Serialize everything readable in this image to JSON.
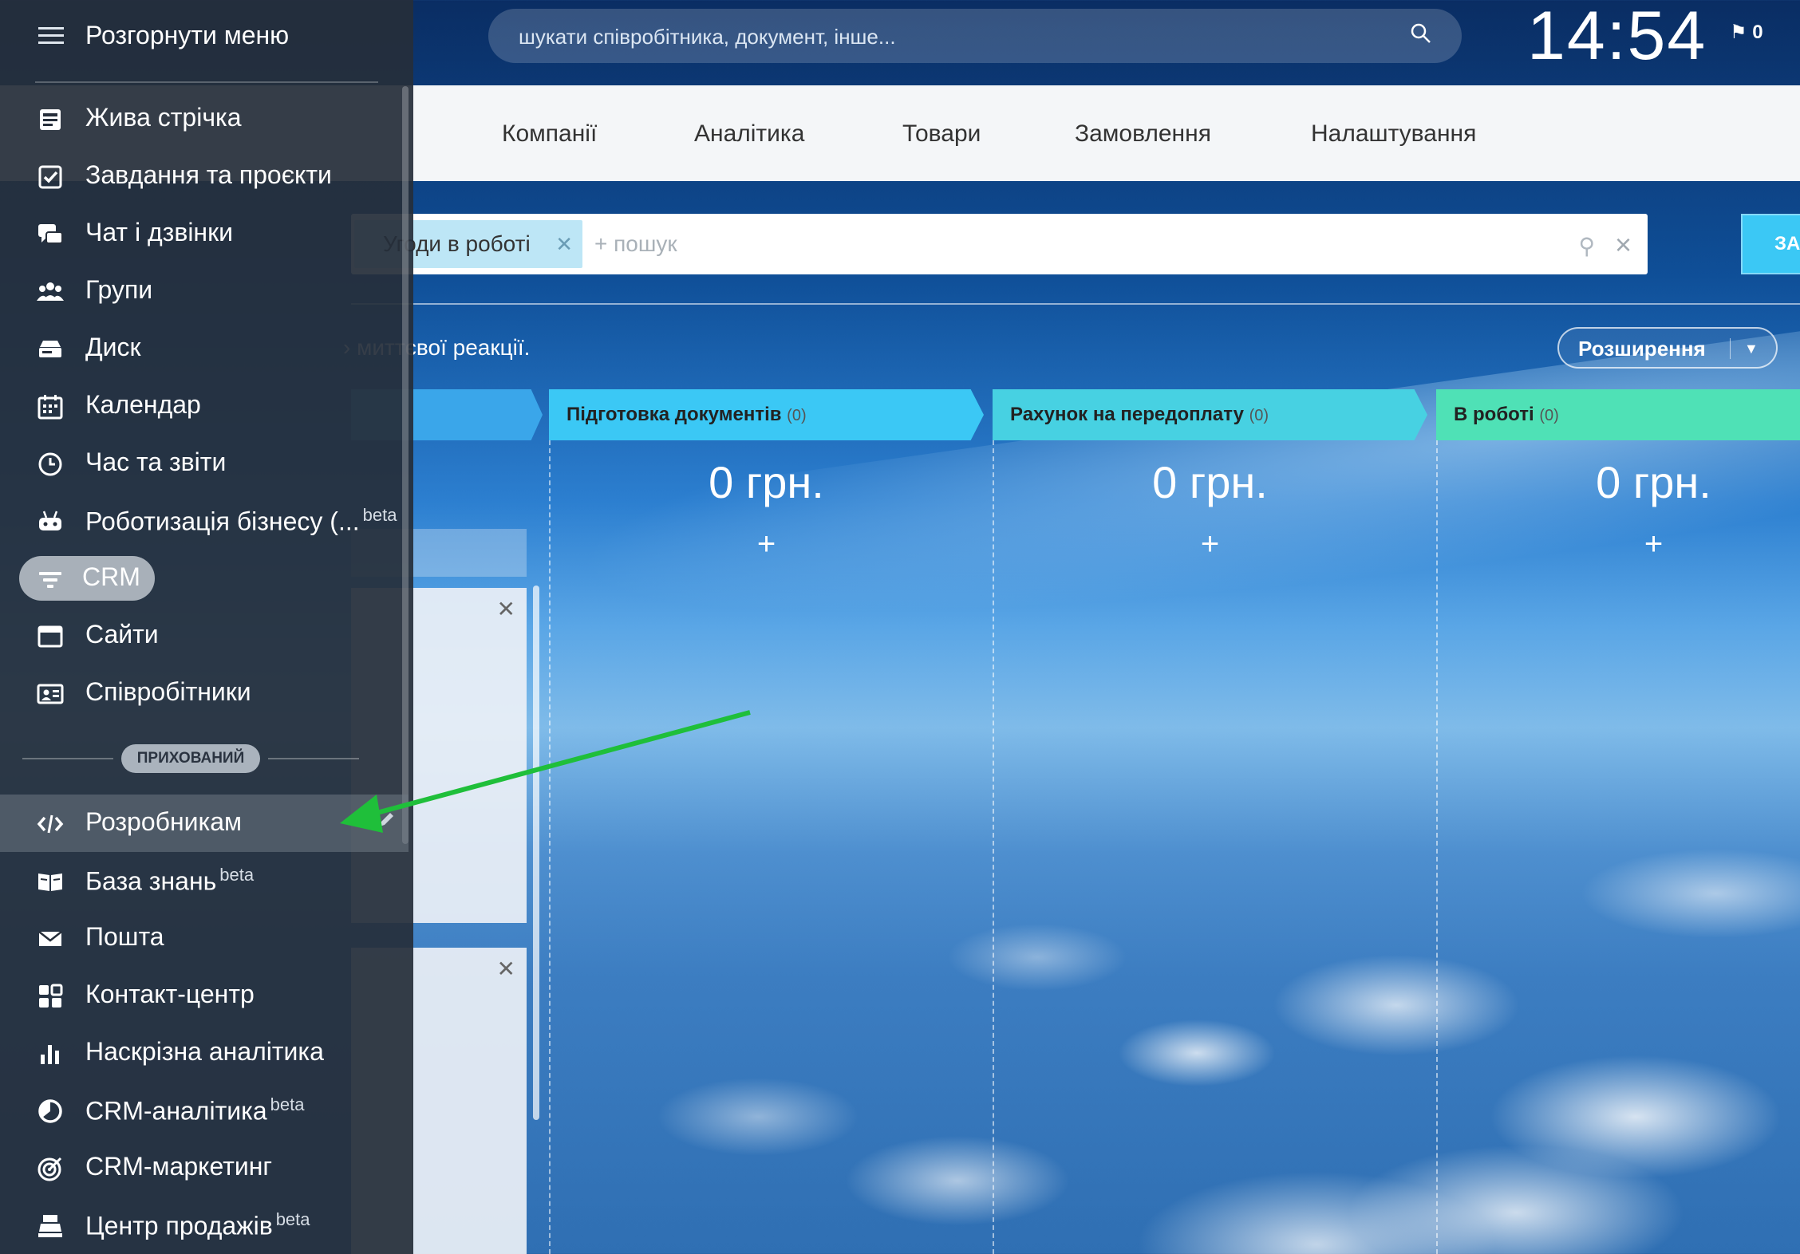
{
  "header": {
    "search_placeholder": "шукати співробітника, документ, інше...",
    "clock": "14:54",
    "flag_count": "0"
  },
  "topnav": {
    "items": [
      "Компанії",
      "Аналітика",
      "Товари",
      "Замовлення",
      "Налаштування"
    ]
  },
  "filter": {
    "chip_label": "Угоди в роботі",
    "search_placeholder": "+ пошук",
    "add_button": "ЗА"
  },
  "notice": "Немає угод, що вимагають миттєвої реакції.",
  "notice_visible": "› миттєвої реакції.",
  "extensions_button": "Розширення",
  "columns": [
    {
      "name": "Підготовка документів",
      "count": "(0)",
      "sum": "0 грн.",
      "color": "#3bc8f5"
    },
    {
      "name": "Рахунок на передоплату",
      "count": "(0)",
      "sum": "0 грн.",
      "color": "#47d1e2"
    },
    {
      "name": "В роботі",
      "count": "(0)",
      "sum": "0 грн.",
      "color": "#4fe1b6"
    }
  ],
  "sidebar": {
    "collapse_label": "Розгорнути меню",
    "items": [
      {
        "label": "Жива стрічка",
        "icon": "feed-icon"
      },
      {
        "label": "Завдання та проєкти",
        "icon": "tasks-icon"
      },
      {
        "label": "Чат і дзвінки",
        "icon": "chat-icon"
      },
      {
        "label": "Групи",
        "icon": "groups-icon"
      },
      {
        "label": "Диск",
        "icon": "disk-icon"
      },
      {
        "label": "Календар",
        "icon": "calendar-icon"
      },
      {
        "label": "Час та звіти",
        "icon": "clock-icon"
      },
      {
        "label": "Роботизація бізнесу (...",
        "icon": "robot-icon",
        "badge": "beta"
      },
      {
        "label": "CRM",
        "icon": "crm-icon",
        "active": true
      },
      {
        "label": "Сайти",
        "icon": "sites-icon"
      },
      {
        "label": "Співробітники",
        "icon": "employees-icon"
      }
    ],
    "hidden_label": "ПРИХОВАНИЙ",
    "hidden_items": [
      {
        "label": "Розробникам",
        "icon": "code-icon"
      },
      {
        "label": "База знань",
        "icon": "book-icon",
        "badge": "beta"
      },
      {
        "label": "Пошта",
        "icon": "mail-icon"
      },
      {
        "label": "Контакт-центр",
        "icon": "grid-icon"
      },
      {
        "label": "Наскрізна аналітика",
        "icon": "bar-chart-icon"
      },
      {
        "label": "CRM-аналітика",
        "icon": "pie-icon",
        "badge": "beta"
      },
      {
        "label": "CRM-маркетинг",
        "icon": "target-icon"
      },
      {
        "label": "Центр продажів",
        "icon": "register-icon",
        "badge": "beta"
      }
    ]
  },
  "colors": {
    "sidebar_bg": "#262e3a",
    "accent": "#3bc8f5",
    "arrow": "#1fbf3a"
  }
}
